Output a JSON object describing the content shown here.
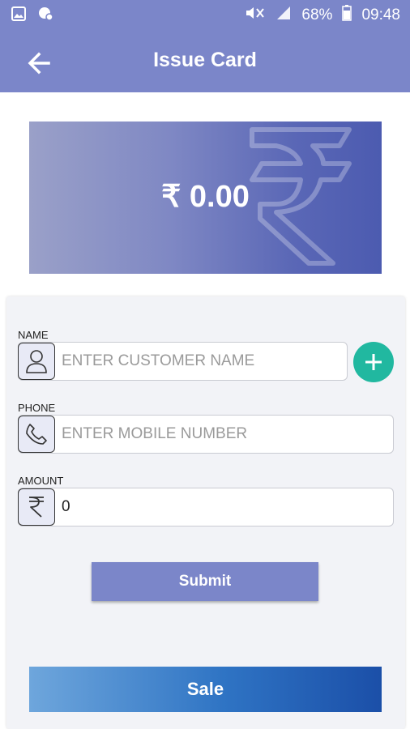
{
  "status_bar": {
    "battery": "68%",
    "time": "09:48",
    "icons": [
      "image-icon",
      "chat-icon",
      "mute-icon",
      "signal-icon",
      "battery-icon"
    ]
  },
  "header": {
    "title": "Issue Card",
    "back_icon": "arrow-left-icon"
  },
  "card": {
    "amount": "₹ 0.00",
    "watermark_icon": "rupee-icon"
  },
  "form": {
    "name_label": "NAME",
    "name_placeholder": "ENTER CUSTOMER NAME",
    "name_icon": "person-icon",
    "add_icon": "plus-icon",
    "phone_label": "PHONE",
    "phone_placeholder": "ENTER MOBILE NUMBER",
    "phone_icon": "phone-icon",
    "amount_label": "AMOUNT",
    "amount_value": "0",
    "amount_icon": "rupee-icon",
    "submit_label": "Submit"
  },
  "sale_label": "Sale",
  "colors": {
    "primary": "#7b86c9",
    "accent": "#21b8a0",
    "sale_gradient_end": "#1b4fa8"
  }
}
